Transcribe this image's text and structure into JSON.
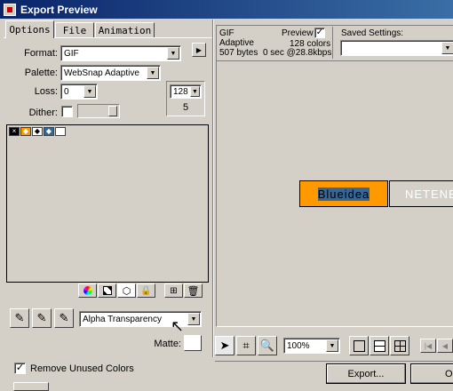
{
  "window": {
    "title": "Export Preview"
  },
  "tabs": [
    {
      "label": "Options"
    },
    {
      "label": "File"
    },
    {
      "label": "Animation"
    }
  ],
  "options": {
    "format_label": "Format:",
    "format_value": "GIF",
    "palette_label": "Palette:",
    "palette_value": "WebSnap Adaptive",
    "loss_label": "Loss:",
    "loss_value": "0",
    "dither_label": "Dither:",
    "colors_value": "128",
    "colors_count": "5",
    "transparency_value": "Alpha Transparency",
    "matte_label": "Matte:",
    "remove_unused_label": "Remove Unused Colors"
  },
  "preview_info": {
    "format": "GIF",
    "palette": "Adaptive",
    "size": "507 bytes",
    "time": "0 sec @28.8kbps",
    "preview_label": "Preview",
    "colors": "128 colors"
  },
  "saved_settings": {
    "label": "Saved Settings:",
    "value": ""
  },
  "canvas": {
    "buttons": [
      {
        "label": "Blueidea",
        "bg": "#ff9900"
      },
      {
        "label": "NETENE",
        "bg": "#336699"
      }
    ]
  },
  "toolbar": {
    "zoom_value": "100%"
  },
  "actions": {
    "export_label": "Export...",
    "ok_label": "OK"
  },
  "icons": {
    "arrow": "pointer-icon",
    "crop": "crop-icon",
    "zoom": "magnifier-icon"
  }
}
